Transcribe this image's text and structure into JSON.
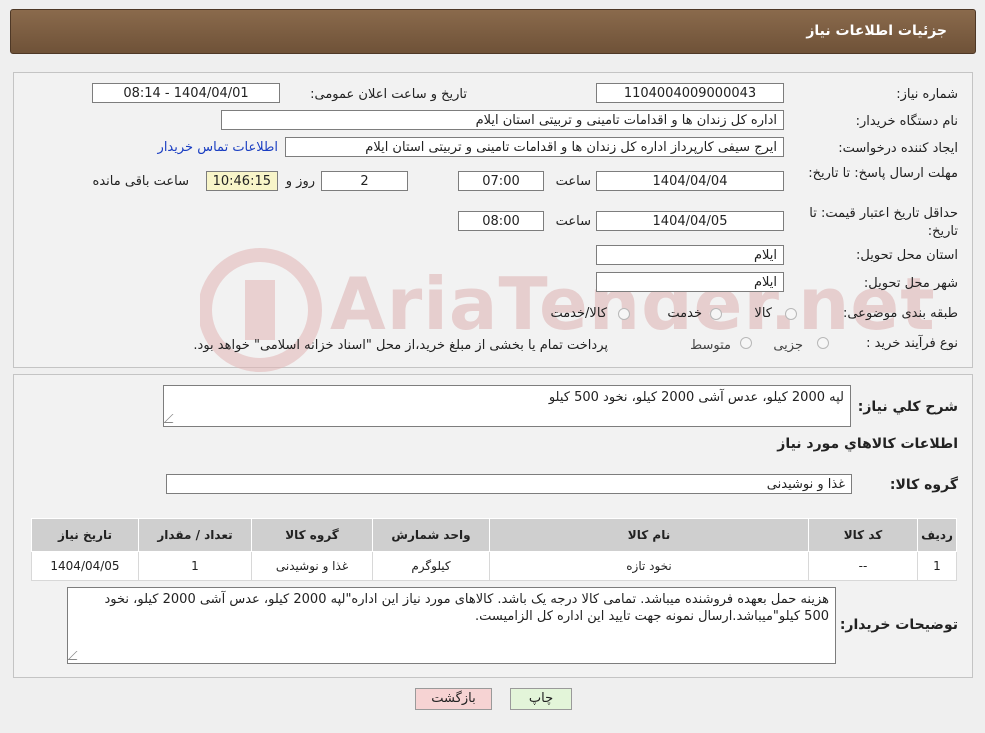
{
  "header": {
    "title": "جزئیات اطلاعات نیاز"
  },
  "form": {
    "need_number_label": "شماره نیاز:",
    "need_number": "1104004009000043",
    "announce_label": "تاریخ و ساعت اعلان عمومی:",
    "announce_value": "1404/04/01 - 08:14",
    "buyer_org_label": "نام دستگاه خریدار:",
    "buyer_org": "اداره کل زندان ها و اقدامات تامینی و تربیتی استان ایلام",
    "requester_label": "ایجاد کننده درخواست:",
    "requester": "ایرج  سیفی کارپرداز اداره کل زندان ها و اقدامات تامینی و تربیتی استان ایلام",
    "contact_link": "اطلاعات تماس خریدار",
    "reply_deadline_label": "مهلت ارسال پاسخ: تا تاریخ:",
    "reply_date": "1404/04/04",
    "time_label": "ساعت",
    "reply_time": "07:00",
    "days_value": "2",
    "days_label": "روز و",
    "remaining_time": "10:46:15",
    "remaining_label": "ساعت باقی مانده",
    "validity_label": "حداقل تاریخ اعتبار قیمت: تا تاریخ:",
    "validity_date": "1404/04/05",
    "validity_time": "08:00",
    "province_label": "استان محل تحویل:",
    "province": "ایلام",
    "city_label": "شهر محل تحویل:",
    "city": "ایلام",
    "category_label": "طبقه بندی موضوعی:",
    "category_options": [
      "کالا",
      "خدمت",
      "کالا/خدمت"
    ],
    "purchase_type_label": "نوع فرآیند خرید :",
    "purchase_options": [
      "جزیی",
      "متوسط"
    ],
    "purchase_note": "پرداخت تمام یا بخشی از مبلغ خرید،از محل \"اسناد خزانه اسلامی\" خواهد بود."
  },
  "details": {
    "summary_label": "شرح کلي نياز:",
    "summary_value": "لپه 2000 کیلو، عدس آشی 2000 کیلو، نخود 500 کیلو",
    "goods_info_title": "اطلاعات کالاهاي مورد نياز",
    "goods_group_label": "گروه کالا:",
    "goods_group_value": "غذا و نوشیدنی",
    "table": {
      "headers": [
        "ردیف",
        "کد کالا",
        "نام کالا",
        "واحد شمارش",
        "گروه کالا",
        "تعداد / مقدار",
        "تاریخ نیاز"
      ],
      "rows": [
        [
          "1",
          "--",
          "نخود تازه",
          "کیلوگرم",
          "غذا و نوشیدنی",
          "1",
          "1404/04/05"
        ]
      ]
    },
    "buyer_notes_label": "توضیحات خریدار:",
    "buyer_notes": "هزینه حمل بعهده فروشنده میباشد. تمامی کالا درجه یک باشد. کالاهای مورد نیاز این اداره\"لپه 2000 کیلو، عدس آشی 2000 کیلو، نخود 500 کیلو\"میباشد.ارسال نمونه جهت تایید این اداره کل الزامیست."
  },
  "buttons": {
    "print": "چاپ",
    "back": "بازگشت"
  },
  "watermark": {
    "text": "AriaTender.net"
  },
  "colors": {
    "header_bg": "#7a5c40",
    "link": "#1a3ec2",
    "back_btn": "#f6d3d3",
    "print_btn": "#e3f5d9"
  }
}
